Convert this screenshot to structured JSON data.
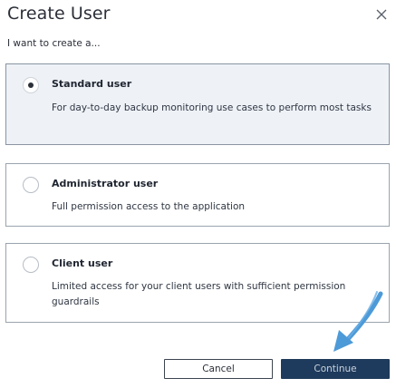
{
  "dialog": {
    "title": "Create User",
    "subtitle": "I want to create a..."
  },
  "options": [
    {
      "title": "Standard user",
      "description": "For day-to-day backup monitoring use cases to perform most tasks",
      "selected": true
    },
    {
      "title": "Administrator user",
      "description": "Full permission access to the application",
      "selected": false
    },
    {
      "title": "Client user",
      "description": "Limited access for your client users with sufficient permission guardrails",
      "selected": false
    }
  ],
  "buttons": {
    "cancel_label": "Cancel",
    "continue_label": "Continue"
  },
  "colors": {
    "selected_bg": "#eef2f7",
    "primary_button": "#1e3a5c",
    "annotation_arrow": "#4d9ad8"
  },
  "icons": {
    "close": "close-icon",
    "annotation": "arrow-annotation-icon"
  }
}
